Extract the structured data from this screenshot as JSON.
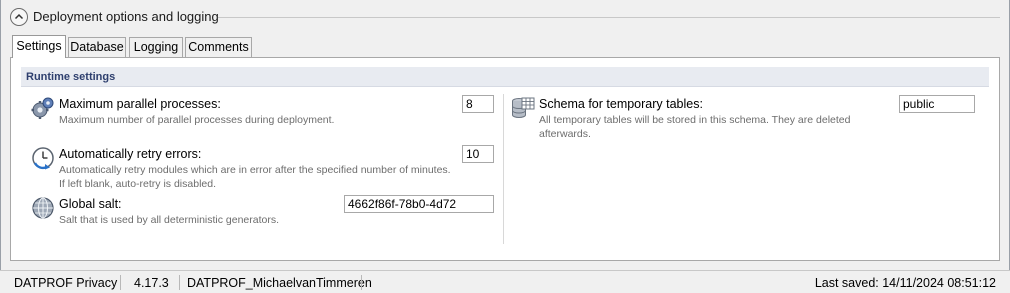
{
  "section": {
    "title": "Deployment options and logging",
    "collapse_icon": "chevron-up-icon"
  },
  "tabs": [
    {
      "label": "Settings",
      "active": true
    },
    {
      "label": "Database",
      "active": false
    },
    {
      "label": "Logging",
      "active": false
    },
    {
      "label": "Comments",
      "active": false
    }
  ],
  "runtime": {
    "group_title": "Runtime settings",
    "max_parallel": {
      "title": "Maximum parallel processes:",
      "description": "Maximum number of parallel processes during deployment.",
      "value": "8",
      "icon": "gears-icon"
    },
    "retry": {
      "title": "Automatically retry errors:",
      "description_line1": "Automatically retry modules which are in error after the specified number of minutes.",
      "description_line2": "If left blank, auto-retry is disabled.",
      "value": "10",
      "icon": "clock-retry-icon"
    },
    "salt": {
      "title": "Global salt:",
      "description": "Salt that is used by all deterministic generators.",
      "value": "4662f86f-78b0-4d72",
      "icon": "globe-icon"
    },
    "schema": {
      "title": "Schema for temporary tables:",
      "description_line1": "All temporary tables will be stored in this schema. They are deleted",
      "description_line2": "afterwards.",
      "value": "public",
      "icon": "database-table-icon"
    }
  },
  "statusbar": {
    "product": "DATPROF Privacy",
    "version": "4.17.3",
    "project": "DATPROF_MichaelvanTimmeren",
    "last_saved": "Last saved: 14/11/2024 08:51:12"
  },
  "colors": {
    "group_header_bg": "#e8ebf1",
    "group_title": "#2e3f6e",
    "description_text": "#6d6d6d"
  }
}
